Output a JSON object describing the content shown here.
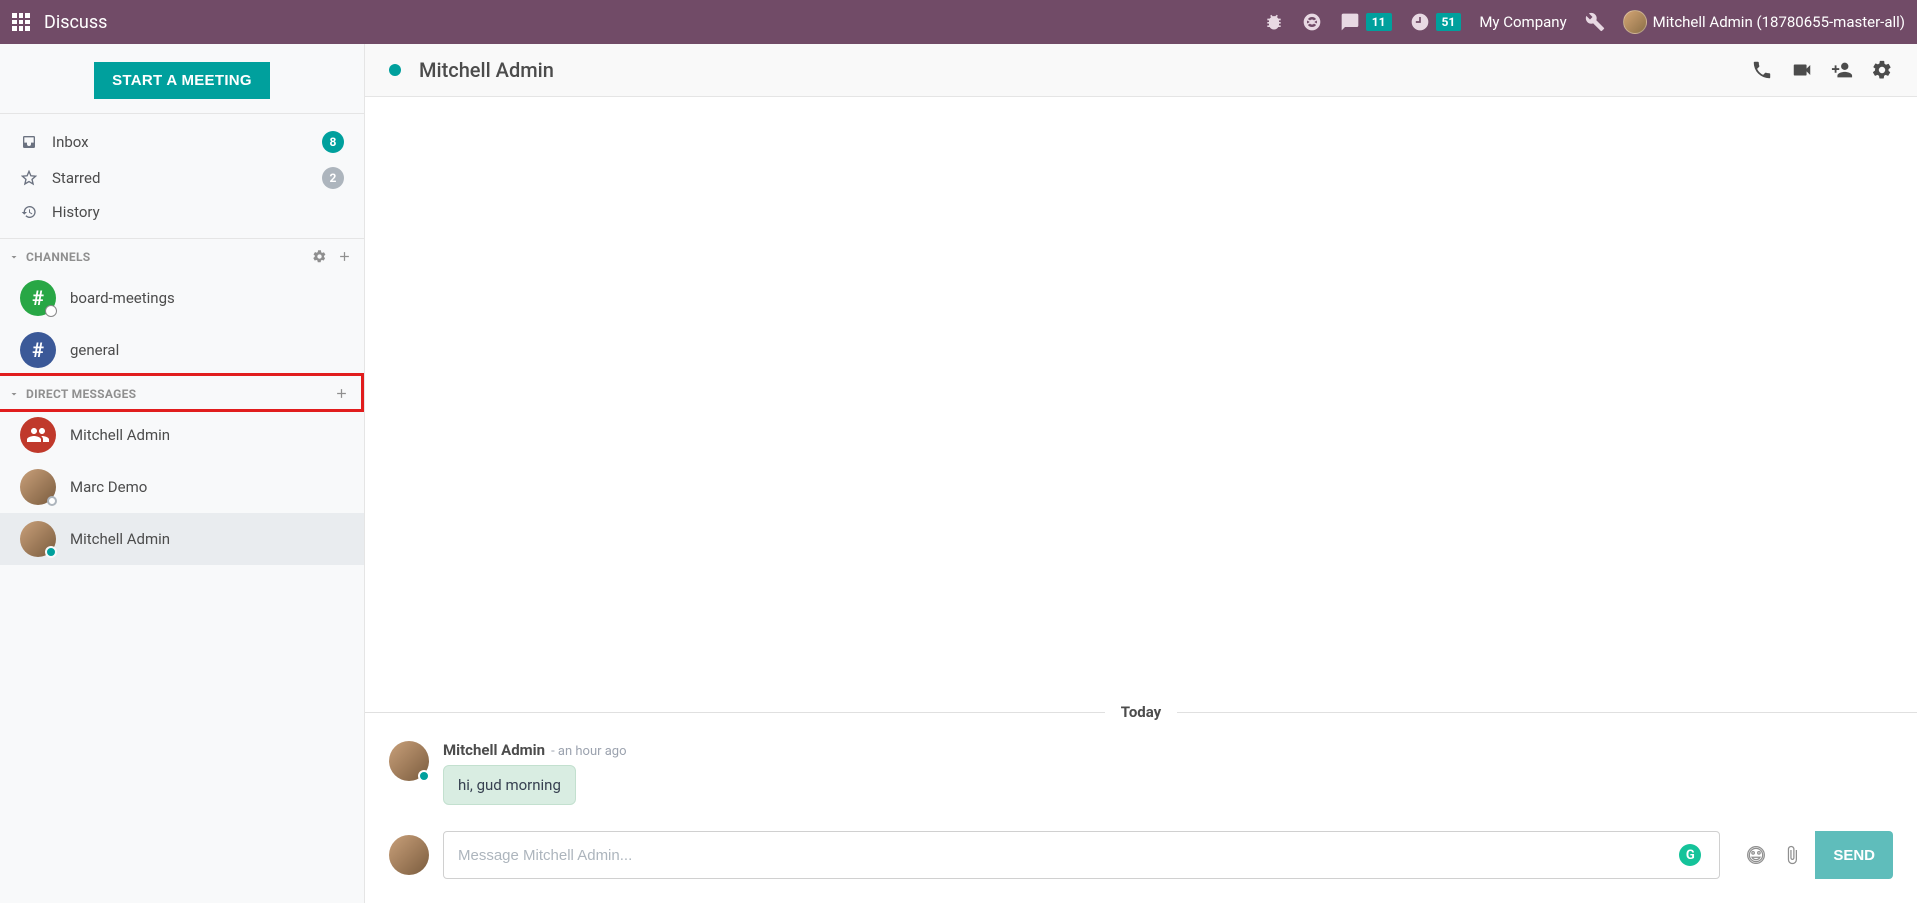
{
  "navbar": {
    "brand": "Discuss",
    "messages_badge": "11",
    "activities_badge": "51",
    "company": "My Company",
    "user": "Mitchell Admin (18780655-master-all)"
  },
  "sidebar": {
    "meeting_button": "START A MEETING",
    "mailboxes": [
      {
        "icon": "inbox",
        "label": "Inbox",
        "badge": "8",
        "badge_style": "teal"
      },
      {
        "icon": "star",
        "label": "Starred",
        "badge": "2",
        "badge_style": "grey"
      },
      {
        "icon": "history",
        "label": "History",
        "badge": "",
        "badge_style": ""
      }
    ],
    "channels_header": "CHANNELS",
    "channels": [
      {
        "label": "board-meetings",
        "color": "green",
        "indicator": "globe"
      },
      {
        "label": "general",
        "color": "blue",
        "indicator": ""
      }
    ],
    "dm_header": "DIRECT MESSAGES",
    "dms": [
      {
        "label": "Mitchell Admin",
        "type": "group",
        "status": ""
      },
      {
        "label": "Marc Demo",
        "type": "user",
        "status": "offline"
      },
      {
        "label": "Mitchell Admin",
        "type": "user",
        "status": "online",
        "active": true
      }
    ]
  },
  "thread": {
    "title": "Mitchell Admin",
    "date_separator": "Today",
    "messages": [
      {
        "author": "Mitchell Admin",
        "time_prefix": "- ",
        "time": "an hour ago",
        "body": "hi, gud morning"
      }
    ],
    "composer_placeholder": "Message Mitchell Admin...",
    "send_label": "SEND"
  }
}
